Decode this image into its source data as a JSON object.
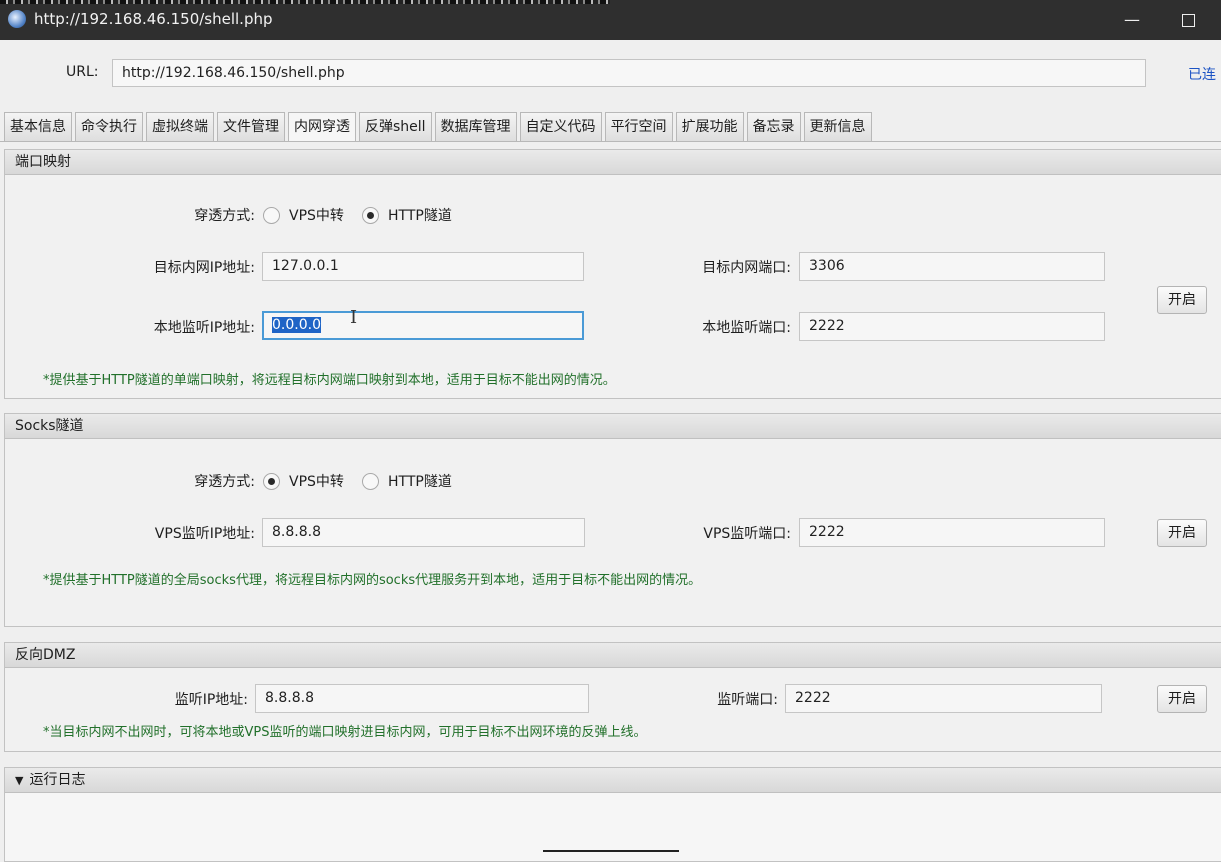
{
  "window": {
    "title": "http://192.168.46.150/shell.php",
    "minimize_glyph": "—",
    "maximize_icon": "maximize-icon"
  },
  "url_bar": {
    "label": "URL:",
    "value": "http://192.168.46.150/shell.php",
    "status": "已连"
  },
  "tabs": [
    "基本信息",
    "命令执行",
    "虚拟终端",
    "文件管理",
    "内网穿透",
    "反弹shell",
    "数据库管理",
    "自定义代码",
    "平行空间",
    "扩展功能",
    "备忘录",
    "更新信息"
  ],
  "active_tab": "内网穿透",
  "port_mapping": {
    "title": "端口映射",
    "mode_label": "穿透方式:",
    "mode_options": [
      "VPS中转",
      "HTTP隧道"
    ],
    "mode_selected": "HTTP隧道",
    "target_ip_label": "目标内网IP地址:",
    "target_ip": "127.0.0.1",
    "target_port_label": "目标内网端口:",
    "target_port": "3306",
    "local_ip_label": "本地监听IP地址:",
    "local_ip": "0.0.0.0",
    "local_port_label": "本地监听端口:",
    "local_port": "2222",
    "button": "开启",
    "note": "*提供基于HTTP隧道的单端口映射，将远程目标内网端口映射到本地，适用于目标不能出网的情况。"
  },
  "socks": {
    "title": "Socks隧道",
    "mode_label": "穿透方式:",
    "mode_options": [
      "VPS中转",
      "HTTP隧道"
    ],
    "mode_selected": "VPS中转",
    "vps_ip_label": "VPS监听IP地址:",
    "vps_ip": "8.8.8.8",
    "vps_port_label": "VPS监听端口:",
    "vps_port": "2222",
    "button": "开启",
    "note": "*提供基于HTTP隧道的全局socks代理，将远程目标内网的socks代理服务开到本地，适用于目标不能出网的情况。"
  },
  "reverse_dmz": {
    "title": "反向DMZ",
    "ip_label": "监听IP地址:",
    "ip": "8.8.8.8",
    "port_label": "监听端口:",
    "port": "2222",
    "button": "开启",
    "note": "*当目标内网不出网时，可将本地或VPS监听的端口映射进目标内网，可用于目标不出网环境的反弹上线。"
  },
  "log": {
    "title": "运行日志",
    "toggle_glyph": "▼"
  },
  "colors": {
    "titlebar": "#2f2f2f",
    "note_green": "#21702a",
    "link_blue": "#1c53c4",
    "selection": "#1f64c6",
    "focus_border": "#4a9ad6"
  }
}
